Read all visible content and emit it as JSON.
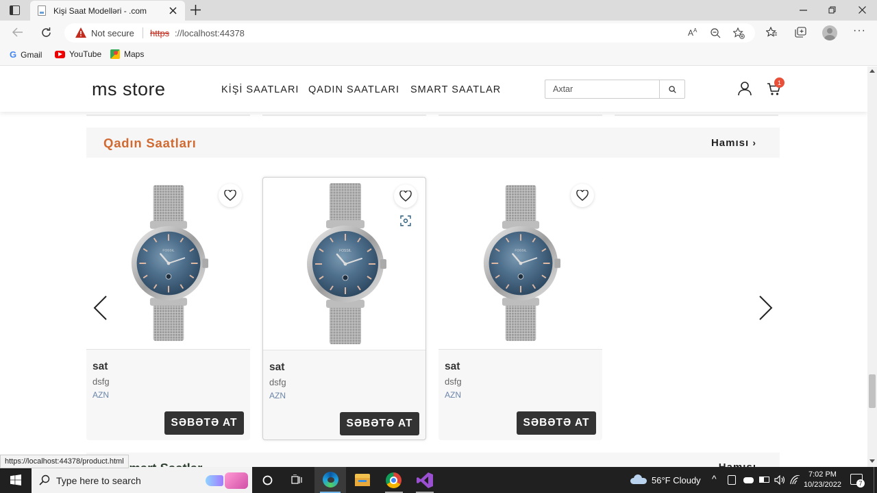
{
  "browser": {
    "tab_title": "Kişi Saat Modelləri - .com",
    "not_secure_label": "Not secure",
    "url_scheme": "https",
    "url_rest": "://localhost:44378",
    "bookmarks": [
      "Gmail",
      "YouTube",
      "Maps"
    ],
    "status_url": "https://localhost:44378/product.html"
  },
  "site": {
    "logo": "ms store",
    "nav": [
      "KİŞİ SAATLARI",
      "QADIN SAATLARI",
      "SMART SAATLAR"
    ],
    "search_placeholder": "Axtar",
    "cart_count": "1",
    "section_title": "Qadın Saatları",
    "see_all": "Hamısı",
    "next_section_title": "Smart Saatlar",
    "next_see_all": "Hamısı",
    "products": [
      {
        "name": "sat",
        "desc": "dsfg",
        "price": "AZN",
        "button": "SƏBƏTƏ AT"
      },
      {
        "name": "sat",
        "desc": "dsfg",
        "price": "AZN",
        "button": "SƏBƏTƏ AT"
      },
      {
        "name": "sat",
        "desc": "dsfg",
        "price": "AZN",
        "button": "SƏBƏTƏ AT"
      }
    ],
    "watch_brand": "FOSSIL"
  },
  "taskbar": {
    "search_placeholder": "Type here to search",
    "weather": "56°F  Cloudy",
    "time": "7:02 PM",
    "date": "10/23/2022",
    "notifications": "7"
  },
  "colors": {
    "accent": "#d06a31",
    "badge": "#e8503a",
    "button": "#333333"
  }
}
